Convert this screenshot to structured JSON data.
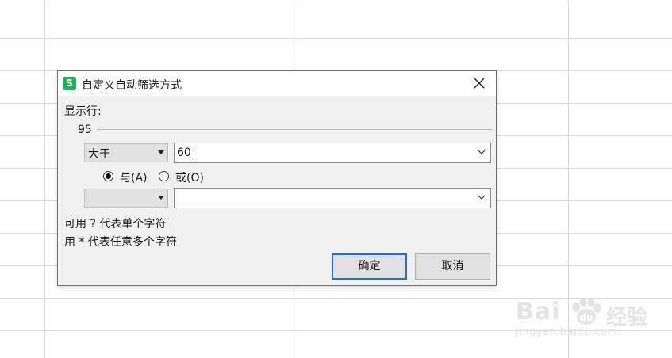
{
  "dialog": {
    "title": "自定义自动筛选方式",
    "app_icon_letter": "S",
    "show_rows_label": "显示行:",
    "field_name": "95",
    "condition1": {
      "operator": "大于",
      "value": "60"
    },
    "logic": {
      "and_label": "与(A)",
      "or_label": "或(O)",
      "selected": "and"
    },
    "condition2": {
      "operator": "",
      "value": ""
    },
    "hint_line1": "可用 ? 代表单个字符",
    "hint_line2": "用 * 代表任意多个字符",
    "ok_label": "确定",
    "cancel_label": "取消"
  },
  "watermark": {
    "brand": "Bai",
    "brand_suffix": "du",
    "cn_text": "经验",
    "url": "jingyan.baidu.com"
  },
  "colors": {
    "app_icon": "#1fb356",
    "primary_border": "#1f6fd1",
    "dialog_bg": "#f0f0f0"
  }
}
